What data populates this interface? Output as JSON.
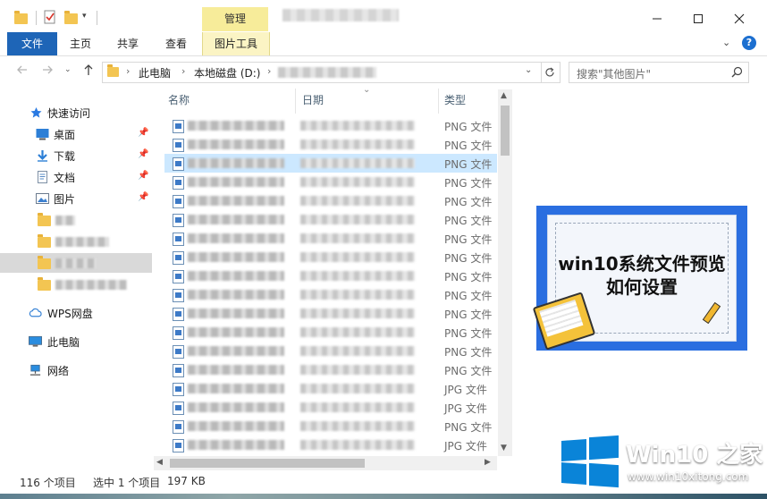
{
  "ribbon": {
    "context_header": "管理",
    "tabs": [
      {
        "label": "文件"
      },
      {
        "label": "主页"
      },
      {
        "label": "共享"
      },
      {
        "label": "查看"
      },
      {
        "label": "图片工具"
      }
    ]
  },
  "address": {
    "crumbs": [
      "此电脑",
      "本地磁盘 (D:)"
    ]
  },
  "search": {
    "placeholder": "搜索\"其他图片\""
  },
  "navpane": {
    "quick_access": "快速访问",
    "pinned": [
      "桌面",
      "下载",
      "文档",
      "图片"
    ],
    "wps": "WPS网盘",
    "this_pc": "此电脑",
    "network": "网络"
  },
  "columns": {
    "name": "名称",
    "date": "日期",
    "type": "类型"
  },
  "files": [
    {
      "type": "PNG 文件"
    },
    {
      "type": "PNG 文件"
    },
    {
      "type": "PNG 文件",
      "selected": true
    },
    {
      "type": "PNG 文件"
    },
    {
      "type": "PNG 文件"
    },
    {
      "type": "PNG 文件"
    },
    {
      "type": "PNG 文件"
    },
    {
      "type": "PNG 文件"
    },
    {
      "type": "PNG 文件"
    },
    {
      "type": "PNG 文件"
    },
    {
      "type": "PNG 文件"
    },
    {
      "type": "PNG 文件"
    },
    {
      "type": "PNG 文件"
    },
    {
      "type": "PNG 文件"
    },
    {
      "type": "JPG 文件"
    },
    {
      "type": "JPG 文件"
    },
    {
      "type": "PNG 文件"
    },
    {
      "type": "JPG 文件"
    }
  ],
  "status": {
    "count": "116 个项目",
    "selection": "选中 1 个项目",
    "size": "197 KB"
  },
  "preview": {
    "line1": "win10系统文件预览",
    "line2": "如何设置"
  },
  "watermark": {
    "title": "Win10 之家",
    "url": "www.win10xitong.com"
  },
  "colors": {
    "accent": "#1e65b7",
    "context_tab": "#f7ec9a",
    "selection": "#cce8ff",
    "preview_bg": "#2a6ee0"
  }
}
